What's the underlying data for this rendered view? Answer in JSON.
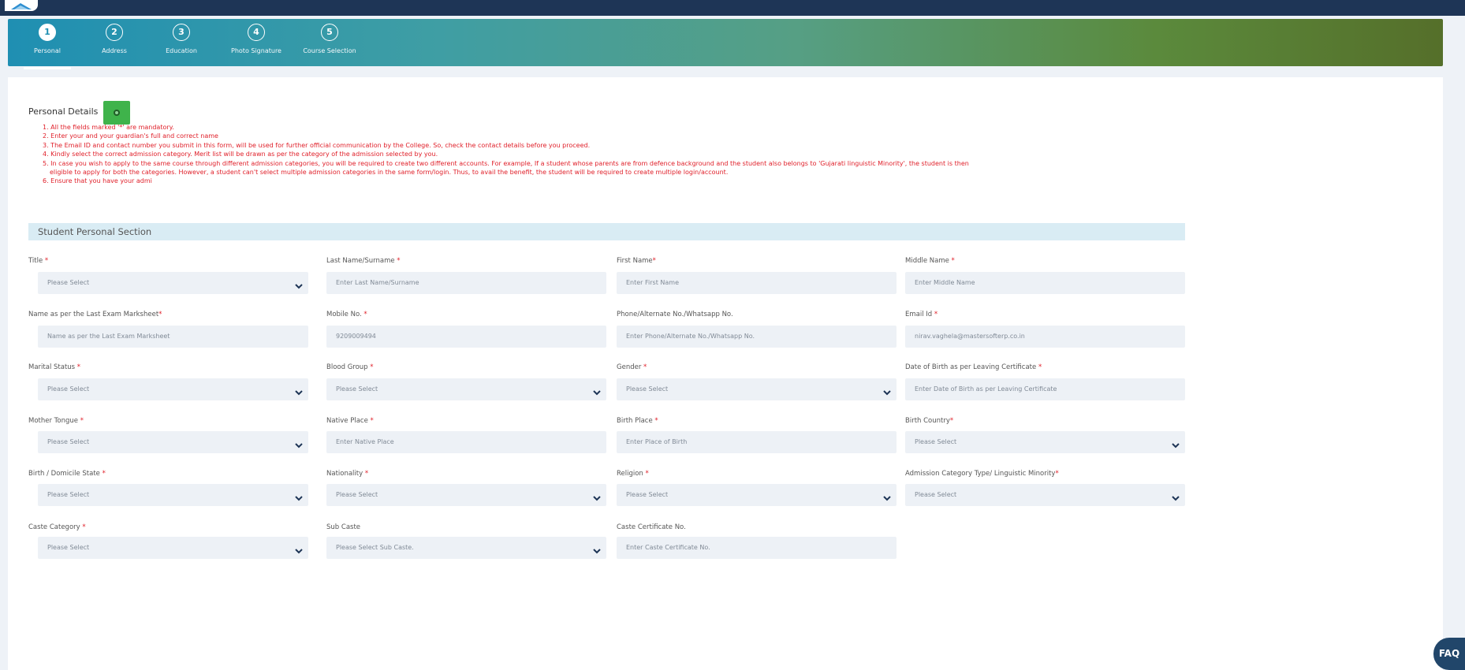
{
  "steps": [
    {
      "num": "1",
      "label": "Personal",
      "active": true
    },
    {
      "num": "2",
      "label": "Address"
    },
    {
      "num": "3",
      "label": "Education"
    },
    {
      "num": "4",
      "label": "Photo Signature"
    },
    {
      "num": "5",
      "label": "Course Selection"
    }
  ],
  "personal": {
    "title": "Personal Details",
    "gear_icon": "gear-icon",
    "notes": [
      "1. All the fields marked '*' are mandatory.",
      "2. Enter your and your guardian's full and correct name",
      "3. The Email ID and contact number you submit in this form, will be used for further official communication by the College. So, check the contact details before you proceed.",
      "4. Kindly select the correct admission category. Merit list will be drawn as per the category of the admission selected by you.",
      "5. In case you wish to apply to the same course through different admission categories, you will be required to create two different accounts. For example, If a student whose parents are from defence background and the student also belongs to 'Gujarati linguistic Minority', the student is then",
      "eligible to apply for both the categories. However, a student can't select multiple admission categories in the same form/login. Thus, to avail the benefit, the student will be required to create multiple login/account.",
      "6. Ensure that you have your admi"
    ]
  },
  "section_title": "Student Personal Section",
  "fields": [
    {
      "label": "Title",
      "req": "*",
      "value": "Please Select",
      "type": "select"
    },
    {
      "label": "Last Name/Surname",
      "req": "*",
      "value": "Enter Last Name/Surname",
      "type": "text"
    },
    {
      "label": "First Name",
      "req": "*",
      "value": "Enter First Name",
      "type": "text"
    },
    {
      "label": "Middle Name",
      "req": "*",
      "value": "Enter Middle Name",
      "type": "text"
    },
    {
      "label": "Name as per the Last Exam Marksheet",
      "req": "*",
      "value": "Name as per the Last Exam Marksheet",
      "type": "text"
    },
    {
      "label": "Mobile No.",
      "req": "*",
      "value": "9209009494",
      "type": "text"
    },
    {
      "label": "Phone/Alternate No./Whatsapp No.",
      "req": "",
      "value": "Enter Phone/Alternate No./Whatsapp No.",
      "type": "text"
    },
    {
      "label": "Email Id",
      "req": "*",
      "value": "nirav.vaghela@mastersofterp.co.in",
      "type": "text"
    },
    {
      "label": "Marital Status",
      "req": "*",
      "value": "Please Select",
      "type": "select"
    },
    {
      "label": "Blood Group",
      "req": "*",
      "value": "Please Select",
      "type": "select"
    },
    {
      "label": "Gender",
      "req": "*",
      "value": "Please Select",
      "type": "select"
    },
    {
      "label": "Date of Birth as per Leaving Certificate",
      "req": "*",
      "value": "Enter Date of Birth as per Leaving Certificate",
      "type": "text"
    },
    {
      "label": "Mother Tongue",
      "req": "*",
      "value": "Please Select",
      "type": "select"
    },
    {
      "label": "Native Place",
      "req": "*",
      "value": "Enter Native Place",
      "type": "text"
    },
    {
      "label": "Birth Place",
      "req": "*",
      "value": "Enter Place of Birth",
      "type": "text"
    },
    {
      "label": "Birth Country",
      "req": "*",
      "value": "Please Select",
      "type": "select"
    },
    {
      "label": "Birth / Domicile State",
      "req": "*",
      "value": "Please Select",
      "type": "select"
    },
    {
      "label": "Nationality",
      "req": "*",
      "value": "Please Select",
      "type": "select"
    },
    {
      "label": "Religion",
      "req": "*",
      "value": "Please Select",
      "type": "select"
    },
    {
      "label": "Admission Category Type/ Linguistic Minority",
      "req": "*",
      "value": "Please Select",
      "type": "select"
    },
    {
      "label": "Caste Category",
      "req": "*",
      "value": "Please Select",
      "type": "select"
    },
    {
      "label": "Sub Caste",
      "req": "",
      "value": "Please Select Sub Caste.",
      "type": "select"
    },
    {
      "label": "Caste Certificate No.",
      "req": "",
      "value": "Enter Caste Certificate No.",
      "type": "text"
    }
  ],
  "faq_label": "FAQ",
  "colors": {
    "accent_red": "#e0202a",
    "header_navy": "#1e3556",
    "section_bg": "#d9ecf4",
    "green_button": "#3fb34b"
  }
}
